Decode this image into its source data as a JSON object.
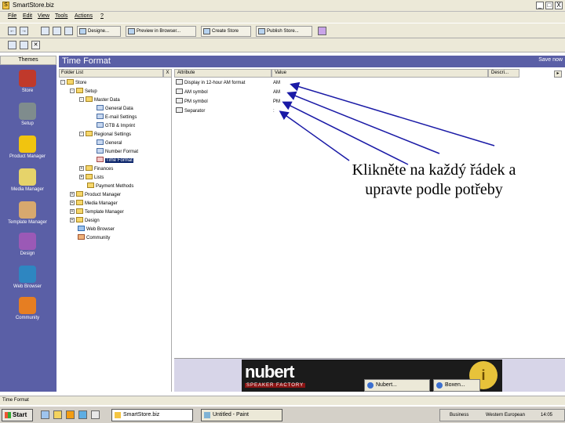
{
  "window": {
    "title": "SmartStore.biz",
    "app_icon": "S",
    "controls": [
      "_",
      "□",
      "X"
    ]
  },
  "menu": [
    "File",
    "Edit",
    "View",
    "Tools",
    "Actions",
    "?"
  ],
  "toolbar": {
    "buttons": [
      "Designe...",
      "Preview in Browser...",
      "Create Store",
      "Publish Store..."
    ]
  },
  "themes_header": "Themes",
  "sidebar": {
    "items": [
      {
        "label": "Store",
        "color": "#c0392b"
      },
      {
        "label": "Setup",
        "color": "#7f8c8d"
      },
      {
        "label": "Product Manager",
        "color": "#f1c40f"
      },
      {
        "label": "Media Manager",
        "color": "#e6d36a"
      },
      {
        "label": "Template Manager",
        "color": "#d7a86e"
      },
      {
        "label": "Design",
        "color": "#9b59b6"
      },
      {
        "label": "Web Browser",
        "color": "#2e86c1"
      },
      {
        "label": "Community",
        "color": "#e67e22"
      }
    ]
  },
  "main": {
    "title": "Time Format",
    "save_label": "Save now"
  },
  "folder_list": {
    "header": "Folder List",
    "close": "X",
    "rows": [
      {
        "label": "Store",
        "expander": "-"
      },
      {
        "label": "Setup",
        "expander": "-"
      },
      {
        "label": "Master Data",
        "expander": "-"
      },
      {
        "label": "General Data",
        "expander": ""
      },
      {
        "label": "E-mail Settings",
        "expander": ""
      },
      {
        "label": "GTB & Imprint",
        "expander": ""
      },
      {
        "label": "Regional Settings",
        "expander": "-"
      },
      {
        "label": "General",
        "expander": ""
      },
      {
        "label": "Number Format",
        "expander": ""
      },
      {
        "label": "Time Format",
        "expander": "",
        "selected": true
      },
      {
        "label": "Finances",
        "expander": "+"
      },
      {
        "label": "Lists",
        "expander": "+"
      },
      {
        "label": "Payment Methods",
        "expander": ""
      },
      {
        "label": "Product Manager",
        "expander": "+"
      },
      {
        "label": "Media Manager",
        "expander": "+"
      },
      {
        "label": "Template Manager",
        "expander": "+"
      },
      {
        "label": "Design",
        "expander": "+"
      },
      {
        "label": "Web Browser",
        "expander": ""
      },
      {
        "label": "Community",
        "expander": ""
      }
    ]
  },
  "attributes": {
    "headers": [
      "Attribute",
      "Value",
      "Descri..."
    ],
    "rows": [
      {
        "attribute": "Display in 12-hour AM format",
        "value": "AM"
      },
      {
        "attribute": "AM symbol",
        "value": "AM"
      },
      {
        "attribute": "PM symbol",
        "value": "PM"
      },
      {
        "attribute": "Separator",
        "value": ":"
      }
    ]
  },
  "annotation": {
    "line1": "Klikněte na každý řádek a",
    "line2": "upravte podle potřeby"
  },
  "banner": {
    "logo": "nubert",
    "tagline": "SPEAKER FACTORY",
    "badge": "i"
  },
  "browser_tabs": [
    "Nubert...",
    "Boxen..."
  ],
  "status": "Time Format",
  "taskbar": {
    "start": "Start",
    "tasks": [
      "SmartStore.biz",
      "Untitled - Paint"
    ],
    "tray": [
      "Business",
      "Western European",
      "14:05"
    ]
  }
}
